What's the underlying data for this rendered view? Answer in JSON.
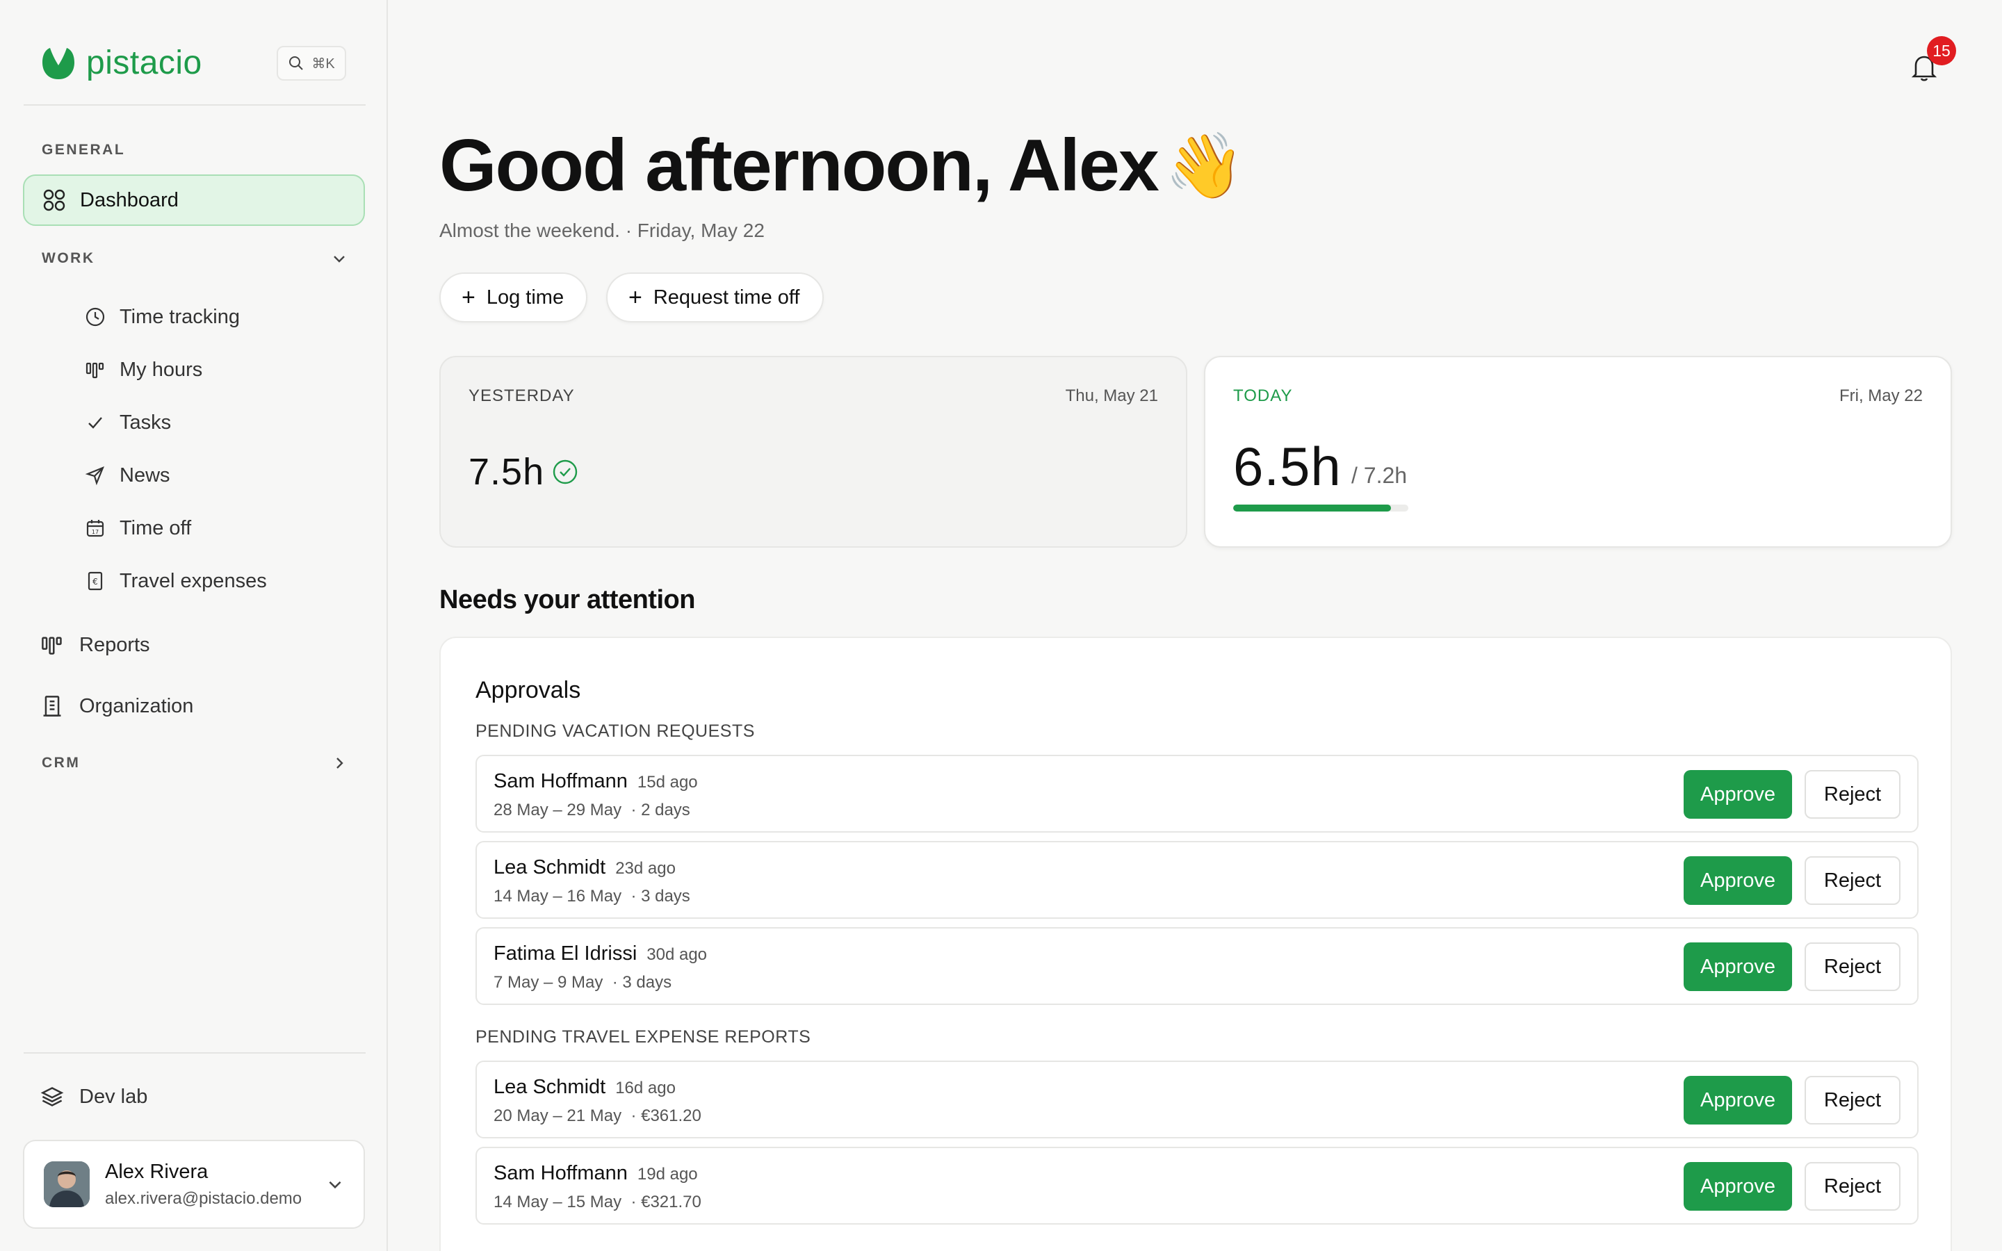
{
  "app": {
    "name": "pistacio",
    "search_shortcut": "⌘K"
  },
  "sidebar": {
    "general_label": "GENERAL",
    "dashboard_label": "Dashboard",
    "work_label": "WORK",
    "work_items": [
      {
        "label": "Time tracking",
        "icon": "clock-icon"
      },
      {
        "label": "My hours",
        "icon": "bar-chart-icon"
      },
      {
        "label": "Tasks",
        "icon": "check-icon"
      },
      {
        "label": "News",
        "icon": "send-icon"
      },
      {
        "label": "Time off",
        "icon": "calendar-icon"
      },
      {
        "label": "Travel expenses",
        "icon": "euro-receipt-icon"
      }
    ],
    "reports_label": "Reports",
    "organization_label": "Organization",
    "crm_label": "CRM",
    "devlab_label": "Dev lab",
    "user": {
      "name": "Alex Rivera",
      "email": "alex.rivera@pistacio.demo"
    }
  },
  "header": {
    "notification_count": "15"
  },
  "main": {
    "greeting": "Good afternoon, Alex",
    "wave_emoji": "👋",
    "subtitle": "Almost the weekend. · Friday, May 22",
    "actions": {
      "log_time": "Log time",
      "request_time_off": "Request time off"
    },
    "yesterday": {
      "label": "YESTERDAY",
      "date": "Thu, May 21",
      "value": "7.5h"
    },
    "today": {
      "label": "TODAY",
      "date": "Fri, May 22",
      "value": "6.5h",
      "target": "/ 7.2h",
      "progress_fraction": 0.9
    },
    "attention_title": "Needs your attention",
    "approvals": {
      "title": "Approvals",
      "approve_label": "Approve",
      "reject_label": "Reject",
      "vacation_label": "PENDING VACATION REQUESTS",
      "vacation_requests": [
        {
          "name": "Sam Hoffmann",
          "age": "15d ago",
          "dates": "28 May – 29 May",
          "extra": "· 2 days"
        },
        {
          "name": "Lea Schmidt",
          "age": "23d ago",
          "dates": "14 May – 16 May",
          "extra": "· 3 days"
        },
        {
          "name": "Fatima El Idrissi",
          "age": "30d ago",
          "dates": "7 May – 9 May",
          "extra": "· 3 days"
        }
      ],
      "travel_label": "PENDING TRAVEL EXPENSE REPORTS",
      "travel_requests": [
        {
          "name": "Lea Schmidt",
          "age": "16d ago",
          "dates": "20 May – 21 May",
          "extra": "· €361.20"
        },
        {
          "name": "Sam Hoffmann",
          "age": "19d ago",
          "dates": "14 May – 15 May",
          "extra": "· €321.70"
        }
      ]
    }
  },
  "colors": {
    "brand": "#1e9b4a",
    "active_nav_bg": "#e2f5e6",
    "badge": "#e11d21"
  }
}
